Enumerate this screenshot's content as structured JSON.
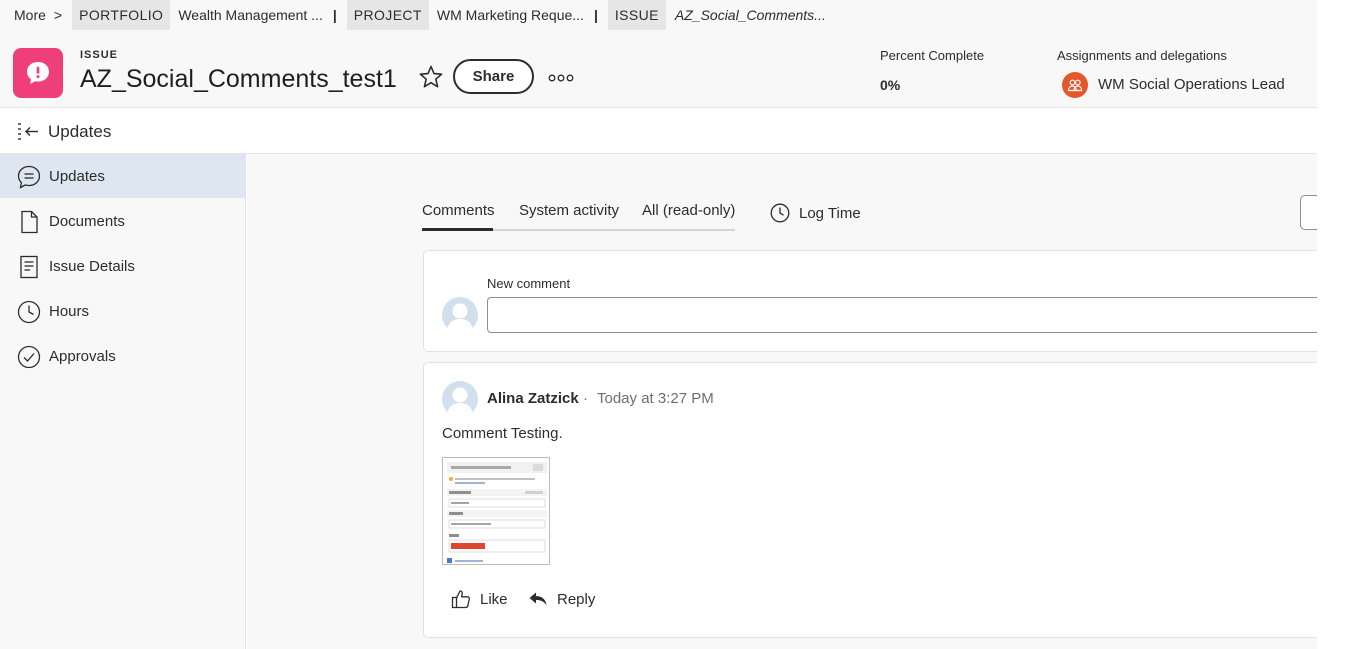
{
  "breadcrumb": {
    "more": "More",
    "more_chevron": ">",
    "portfolio_label": "PORTFOLIO",
    "portfolio_name": "Wealth Management ...",
    "project_label": "PROJECT",
    "project_name": "WM Marketing Reque...",
    "issue_label": "ISSUE",
    "issue_name": "AZ_Social_Comments...",
    "separator": "|"
  },
  "header": {
    "type": "ISSUE",
    "title": "AZ_Social_Comments_test1",
    "share_label": "Share",
    "percent_complete_label": "Percent Complete",
    "percent_complete_value": "0%",
    "assignments_label": "Assignments and delegations",
    "assignee": "WM Social Operations Lead"
  },
  "panel": {
    "title": "Updates"
  },
  "sidebar": {
    "items": [
      {
        "label": "Updates",
        "icon": "chat-bubble-icon",
        "active": true
      },
      {
        "label": "Documents",
        "icon": "document-icon",
        "active": false
      },
      {
        "label": "Issue Details",
        "icon": "details-icon",
        "active": false
      },
      {
        "label": "Hours",
        "icon": "clock-icon",
        "active": false
      },
      {
        "label": "Approvals",
        "icon": "check-circle-icon",
        "active": false
      }
    ]
  },
  "main": {
    "tabs": [
      {
        "label": "Comments",
        "active": true
      },
      {
        "label": "System activity",
        "active": false
      },
      {
        "label": "All (read-only)",
        "active": false
      }
    ],
    "log_time_label": "Log Time",
    "new_comment_label": "New comment",
    "new_comment_value": "",
    "comment": {
      "author": "Alina Zatzick",
      "separator": "·",
      "time": "Today at 3:27 PM",
      "text": "Comment Testing.",
      "like_label": "Like",
      "reply_label": "Reply"
    }
  },
  "colors": {
    "issue_logo": "#ee3f7a",
    "assignee_avatar": "#e5572a",
    "active_nav": "#dde6f1",
    "panel_bg": "#f8f8f8"
  }
}
